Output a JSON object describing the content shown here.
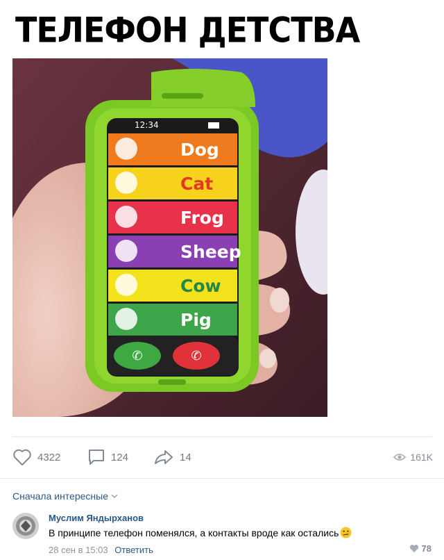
{
  "post": {
    "title": "ТЕЛЕФОН ДЕТСТВА",
    "phone": {
      "status_time": "12:34",
      "contacts": [
        {
          "label": "Dog",
          "bg": "#f07a1e",
          "text_color": "#ffffff"
        },
        {
          "label": "Cat",
          "bg": "#f6d21c",
          "text_color": "#e23a1f"
        },
        {
          "label": "Frog",
          "bg": "#e8324a",
          "text_color": "#ffffff"
        },
        {
          "label": "Sheep",
          "bg": "#8a3fb3",
          "text_color": "#ffffff"
        },
        {
          "label": "Cow",
          "bg": "#f3e21c",
          "text_color": "#23864a"
        },
        {
          "label": "Pig",
          "bg": "#3fa54a",
          "text_color": "#ffffff"
        }
      ]
    }
  },
  "actions": {
    "likes": "4322",
    "comments": "124",
    "shares": "14",
    "views": "161K"
  },
  "comments_section": {
    "sort_label": "Сначала интересные",
    "items": [
      {
        "author": "Муслим Яндырханов",
        "text": "В принципе телефон поменялся, а контакты вроде как остались",
        "date": "28 сен в 15:03",
        "reply_label": "Ответить",
        "likes": "78"
      }
    ]
  },
  "colors": {
    "link": "#2a5885",
    "muted": "#828a99",
    "divider": "#e7e8ec",
    "toy_green": "#86d12a"
  }
}
